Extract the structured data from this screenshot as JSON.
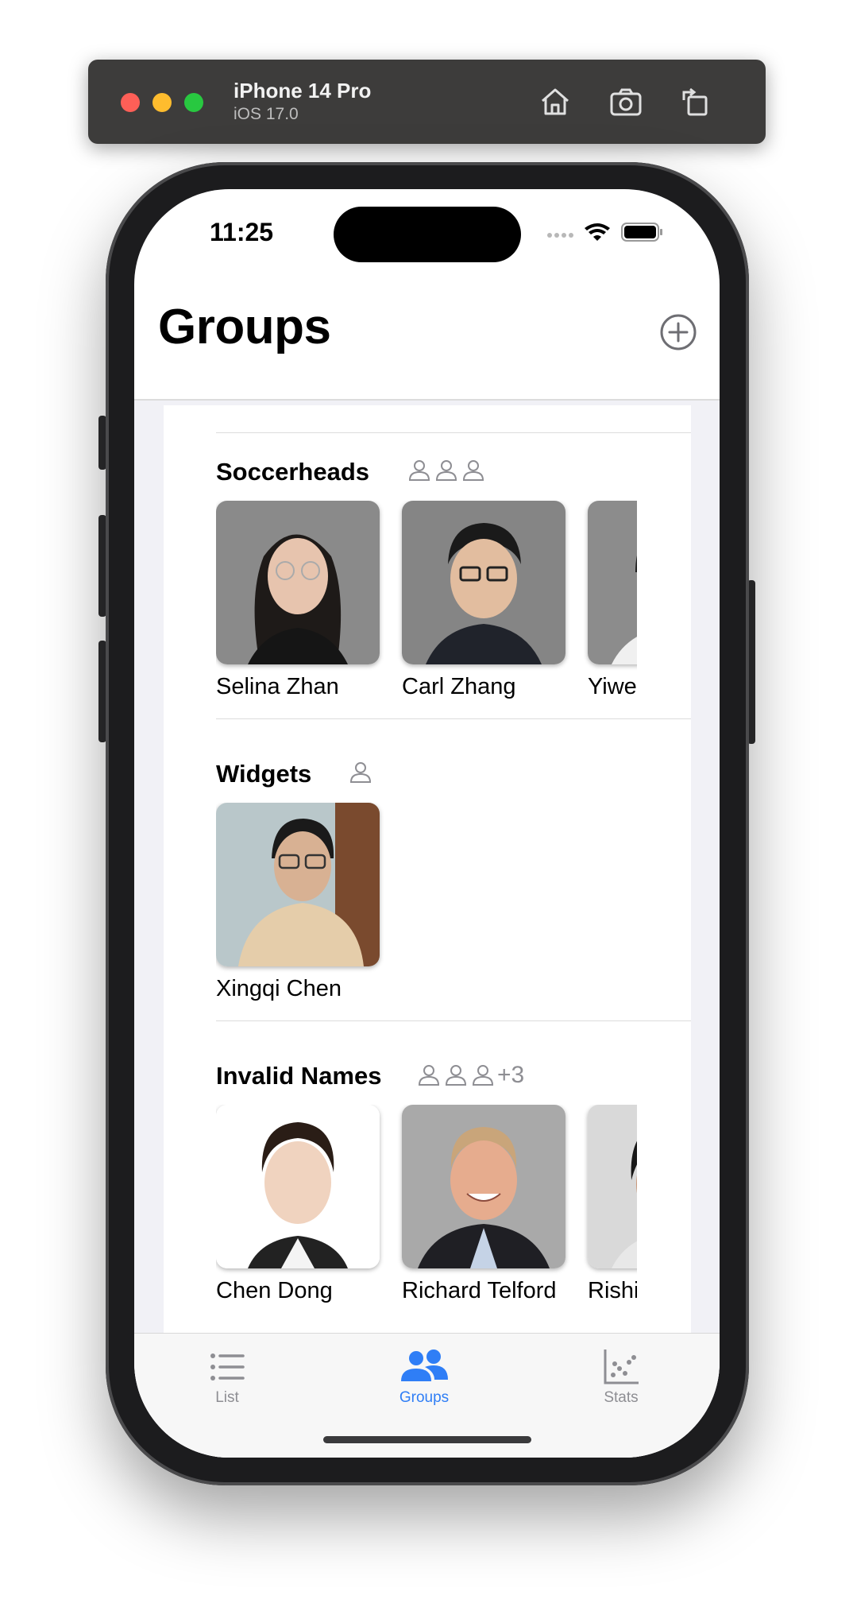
{
  "simulator": {
    "device": "iPhone 14 Pro",
    "os": "iOS 17.0",
    "icons": [
      "home-icon",
      "screenshot-icon",
      "rotate-icon"
    ]
  },
  "status_bar": {
    "time": "11:25"
  },
  "header": {
    "title": "Groups",
    "add_icon": "plus-circle-icon"
  },
  "groups": [
    {
      "name": "Soccerheads",
      "extra_count": "",
      "members": [
        {
          "name": "Selina Zhan"
        },
        {
          "name": "Carl Zhang"
        },
        {
          "name": "Yiwe"
        }
      ]
    },
    {
      "name": "Widgets",
      "extra_count": "",
      "members": [
        {
          "name": "Xingqi Chen"
        }
      ]
    },
    {
      "name": "Invalid Names",
      "extra_count": "+3",
      "members": [
        {
          "name": "Chen Dong"
        },
        {
          "name": "Richard Telford"
        },
        {
          "name": "Rishi"
        }
      ]
    }
  ],
  "tabbar": {
    "tabs": [
      {
        "label": "List",
        "icon": "list-icon"
      },
      {
        "label": "Groups",
        "icon": "person-2-icon",
        "active": true
      },
      {
        "label": "Stats",
        "icon": "scatter-chart-icon"
      }
    ]
  },
  "colors": {
    "accent": "#2f7ef6",
    "inactive": "#8e8e93",
    "grouped_background": "#f1f1f6"
  }
}
